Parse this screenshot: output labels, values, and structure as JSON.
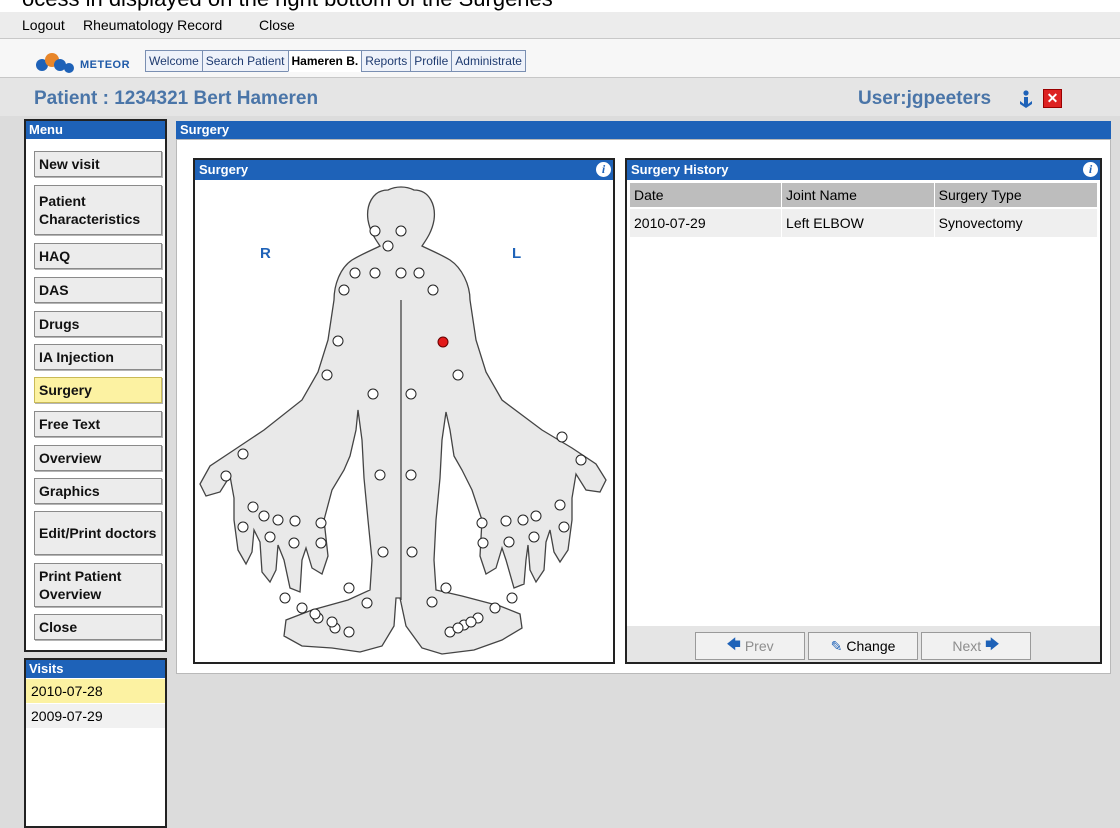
{
  "caption": "ocess in displayed on the right bottom of the Surgeries",
  "menubar": {
    "logout": "Logout",
    "record": "Rheumatology Record",
    "close": "Close"
  },
  "logo": {
    "text": "METEOR"
  },
  "tabs": [
    "Welcome",
    "Search Patient",
    "Hameren B.",
    "Reports",
    "Profile",
    "Administrate"
  ],
  "activeTab": "Hameren B.",
  "patient": {
    "title": "Patient : 1234321 Bert Hameren",
    "user": "User:jgpeeters"
  },
  "menu": {
    "title": "Menu",
    "items": [
      "New visit",
      "Patient Characteristics",
      "HAQ",
      "DAS",
      "Drugs",
      "IA Injection",
      "Surgery",
      "Free Text",
      "Overview",
      "Graphics",
      "Edit/Print doctors",
      "Print Patient Overview",
      "Close"
    ],
    "active": "Surgery"
  },
  "visits": {
    "title": "Visits",
    "items": [
      "2010-07-28",
      "2009-07-29"
    ],
    "selected": "2010-07-28"
  },
  "main": {
    "title": "Surgery"
  },
  "surgery": {
    "title": "Surgery",
    "right_label": "R",
    "left_label": "L",
    "selected_joint": "left-elbow"
  },
  "history": {
    "title": "Surgery History",
    "columns": [
      "Date",
      "Joint Name",
      "Surgery Type"
    ],
    "rows": [
      [
        "2010-07-29",
        "Left ELBOW",
        "Synovectomy"
      ]
    ],
    "buttons": {
      "prev": "Prev",
      "change": "Change",
      "next": "Next"
    }
  },
  "colors": {
    "header_blue": "#1e62b8",
    "active_yellow": "#fcf2a2",
    "selected_joint": "#e21a1a"
  }
}
